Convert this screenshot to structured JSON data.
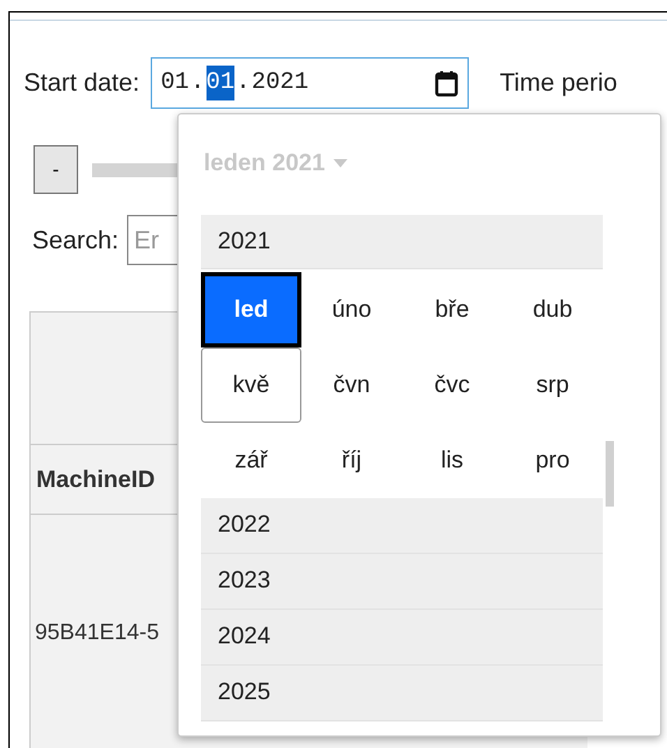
{
  "start_date": {
    "label": "Start date:",
    "separator": ".",
    "segments": [
      {
        "text": "01",
        "selected": false
      },
      {
        "text": "01",
        "selected": true
      },
      {
        "text": "2021",
        "selected": false
      }
    ]
  },
  "time_period": {
    "label": "Time perio"
  },
  "zoom_out_button": {
    "label": "-"
  },
  "search": {
    "label": "Search:",
    "placeholder": "Er"
  },
  "table": {
    "header": "MachineID",
    "cell": "95B41E14-5"
  },
  "picker": {
    "title": "leden 2021",
    "years": [
      {
        "label": "2021",
        "expanded": true
      },
      {
        "label": "2022",
        "expanded": false
      },
      {
        "label": "2023",
        "expanded": false
      },
      {
        "label": "2024",
        "expanded": false
      },
      {
        "label": "2025",
        "expanded": false
      }
    ],
    "months": [
      {
        "label": "led",
        "selected": true,
        "hovered": false
      },
      {
        "label": "úno",
        "selected": false,
        "hovered": false
      },
      {
        "label": "bře",
        "selected": false,
        "hovered": false
      },
      {
        "label": "dub",
        "selected": false,
        "hovered": false
      },
      {
        "label": "kvě",
        "selected": false,
        "hovered": true
      },
      {
        "label": "čvn",
        "selected": false,
        "hovered": false
      },
      {
        "label": "čvc",
        "selected": false,
        "hovered": false
      },
      {
        "label": "srp",
        "selected": false,
        "hovered": false
      },
      {
        "label": "zář",
        "selected": false,
        "hovered": false
      },
      {
        "label": "říj",
        "selected": false,
        "hovered": false
      },
      {
        "label": "lis",
        "selected": false,
        "hovered": false
      },
      {
        "label": "pro",
        "selected": false,
        "hovered": false
      }
    ]
  }
}
